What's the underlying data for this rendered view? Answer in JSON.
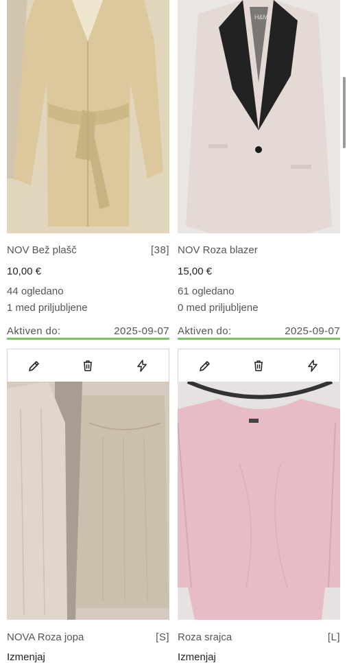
{
  "items": [
    {
      "title": "NOV Bež plašč",
      "size": "[38]",
      "price": "10,00 €",
      "views": "44 ogledano",
      "favorites": "1 med priljubljene",
      "active_label": "Aktiven do:",
      "active_date": "2025-09-07"
    },
    {
      "title": "NOV Roza blazer",
      "size": "",
      "price": "15,00 €",
      "views": "61 ogledano",
      "favorites": "0 med priljubljene",
      "active_label": "Aktiven do:",
      "active_date": "2025-09-07"
    },
    {
      "title": "NOVA Roza jopa",
      "size": "[S]",
      "status": "Izmenjaj"
    },
    {
      "title": "Roza srajca",
      "size": "[L]",
      "status": "Izmenjaj"
    }
  ],
  "photo_labels": {
    "blazer_brand": "H&M"
  },
  "icons": {
    "edit": "pencil-icon",
    "delete": "trash-icon",
    "boost": "lightning-icon"
  },
  "colors": {
    "active_underline": "#7cc36a"
  }
}
